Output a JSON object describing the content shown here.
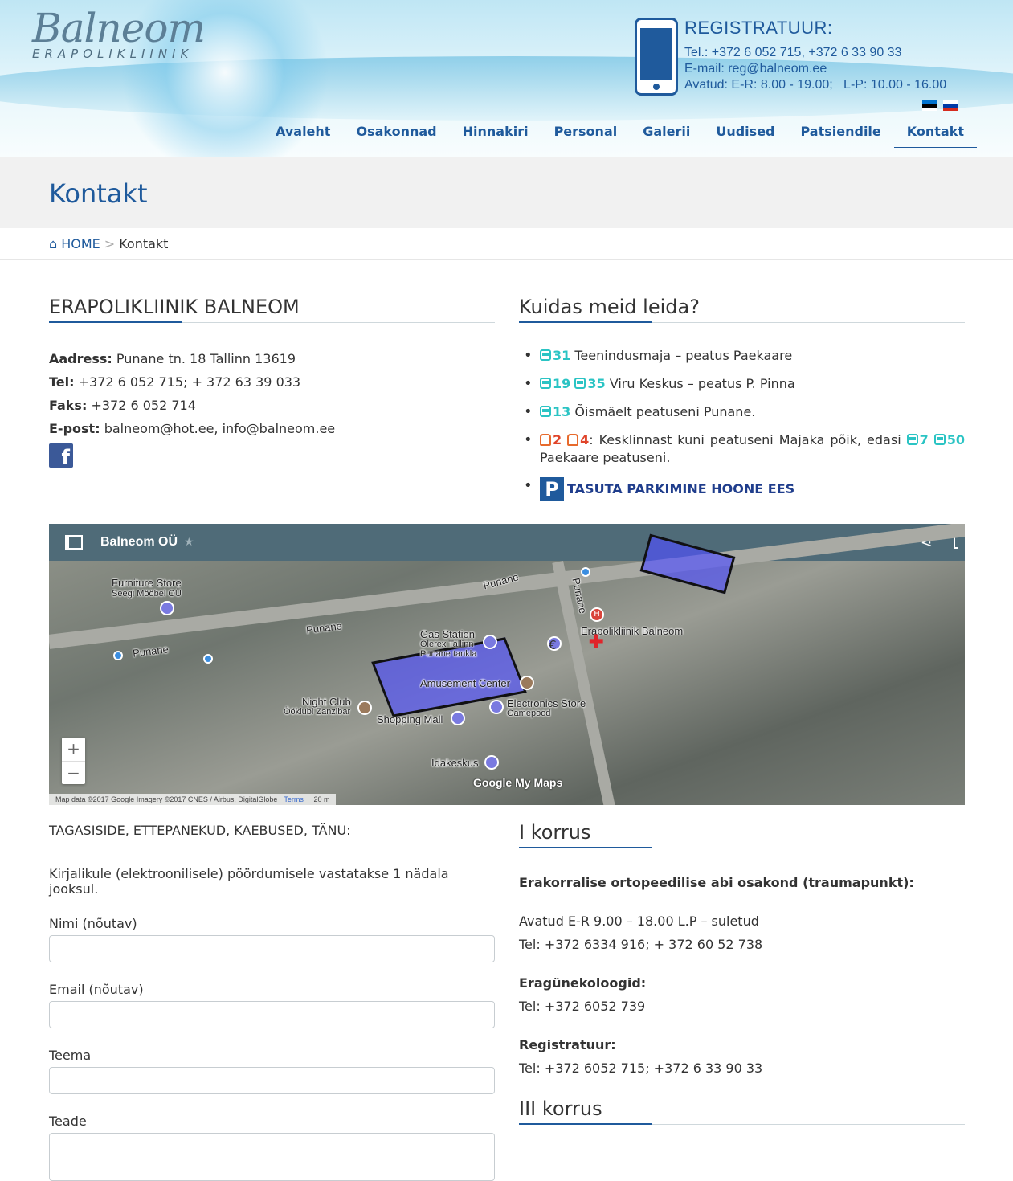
{
  "header": {
    "logo_main": "Balneom",
    "logo_sub": "ERAPOLIKLIINIK",
    "reg_title": "REGISTRATUUR:",
    "reg_phone": "Tel.: +372 6 052 715, +372 6 33 90 33",
    "reg_email": "E-mail: reg@balneom.ee",
    "reg_hours": "Avatud: E-R: 8.00 - 19.00;   L-P: 10.00 - 16.00",
    "nav": [
      "Avaleht",
      "Osakonnad",
      "Hinnakiri",
      "Personal",
      "Galerii",
      "Uudised",
      "Patsiendile",
      "Kontakt"
    ],
    "active_nav": "Kontakt"
  },
  "page": {
    "title": "Kontakt",
    "breadcrumb_home": "HOME",
    "breadcrumb_sep": ">",
    "breadcrumb_current": "Kontakt"
  },
  "clinic": {
    "title": "ERAPOLIKLIINIK BALNEOM",
    "address_label": "Aadress:",
    "address": "Punane tn. 18 Tallinn 13619",
    "tel_label": "Tel:",
    "tel": "+372 6 052 715; + 372 63 39 033",
    "fax_label": "Faks:",
    "fax": "+372 6 052 714",
    "email_label": "E-post:",
    "email": "balneom@hot.ee, info@balneom.ee"
  },
  "directions": {
    "title": "Kuidas meid leida?",
    "r1_num": "31",
    "r1_text": "Teenindusmaja – peatus Paekaare",
    "r2_num_a": "19",
    "r2_num_b": "35",
    "r2_text": "Viru Keskus – peatus P. Pinna",
    "r3_num": "13",
    "r3_text": "Õismäelt peatuseni Punane.",
    "r4_tram_a": "2",
    "r4_tram_b": "4",
    "r4_text": ": Kesklinnast kuni peatuseni Majaka põik, edasi ",
    "r4_bus_a": "7",
    "r4_bus_b": "50",
    "r4_end": "Paekaare peatuseni.",
    "parking_sign": "P",
    "parking": "TASUTA PARKIMINE HOONE EES"
  },
  "map": {
    "title": "Balneom OÜ",
    "labels": {
      "furniture": "Furniture Store",
      "furniture_sub": "Seegi Mööbel OÜ",
      "punane_1": "Punane",
      "punane_2": "Punane",
      "punane_3": "Punane",
      "punane_4": "Punane",
      "gas": "Gas Station",
      "gas_sub": "Olerex Tallinn Punane tankla",
      "amusement": "Amusement Center",
      "night_club": "Night Club",
      "night_club_sub": "Ööklubi Zanzibar",
      "mall": "Shopping Mall",
      "electronics": "Electronics Store",
      "electronics_sub": "Gamepood",
      "clinic": "Erapolikliinik Balneom",
      "idakeskus": "Idakeskus",
      "hospital_mark": "H",
      "euro_mark": "€"
    },
    "attribution": "Map data ©2017 Google Imagery ©2017 CNES / Airbus, DigitalGlobe",
    "terms": "Terms",
    "scale": "20 m",
    "logo": "Google My Maps",
    "zoom_in": "+",
    "zoom_out": "−"
  },
  "feedback": {
    "title": "TAGASISIDE, ETTEPANEKUD, KAEBUSED, TÄNU:",
    "note": "Kirjalikule (elektroonilisele) pöördumisele vastatakse 1 nädala jooksul.",
    "name_label": "Nimi (nõutav)",
    "email_label": "Email (nõutav)",
    "subject_label": "Teema",
    "message_label": "Teade"
  },
  "floors": {
    "floor1_title": "I korrus",
    "trauma_title": "Erakorralise ortopeedilise abi osakond (traumapunkt):",
    "trauma_hours": "Avatud E-R 9.00 – 18.00 L.P – suletud",
    "trauma_tel": "Tel: +372 6334 916; + 372 60 52 738",
    "gyn_title": "Eragünekoloogid:",
    "gyn_tel": "Tel: +372 6052 739",
    "reg_title": "Registratuur:",
    "reg_tel": "Tel: +372 6052 715; +372 6 33 90 33",
    "floor3_title": "III korrus"
  },
  "colors": {
    "brand_blue": "#1f5a9c",
    "bus_teal": "#2bc4c4",
    "tram_red": "#e0442a"
  }
}
